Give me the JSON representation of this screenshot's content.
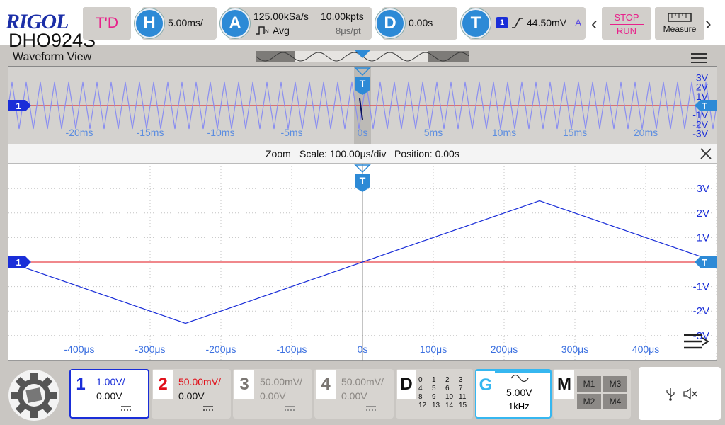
{
  "header": {
    "logo": "RIGOL",
    "model": "DHO924S",
    "td_button": "T'D",
    "horizontal": {
      "icon": "H",
      "scale": "5.00ms/"
    },
    "acquire": {
      "icon": "A",
      "sample_rate": "125.00kSa/s",
      "points": "10.00kpts",
      "mode": "Avg",
      "time_per_point": "8μs/pt"
    },
    "delay": {
      "icon": "D",
      "value": "0.00s"
    },
    "trigger": {
      "icon": "T",
      "source": "1",
      "level": "44.50mV",
      "mode": "A"
    },
    "stop_label": "STOP",
    "run_label": "RUN",
    "measure_label": "Measure"
  },
  "view": {
    "title": "Waveform View"
  },
  "overview": {
    "time_labels": [
      "-20ms",
      "-15ms",
      "-10ms",
      "-5ms",
      "0s",
      "5ms",
      "10ms",
      "15ms",
      "20ms"
    ],
    "volt_labels": [
      "3V",
      "2V",
      "1V",
      "-1V",
      "-2V",
      "-3V"
    ],
    "trigger_marker": "T",
    "channel_marker": "1"
  },
  "zoom": {
    "title": "Zoom",
    "scale": "Scale: 100.00μs/div",
    "position": "Position: 0.00s",
    "time_labels": [
      "-400μs",
      "-300μs",
      "-200μs",
      "-100μs",
      "0s",
      "100μs",
      "200μs",
      "300μs",
      "400μs"
    ],
    "volt_labels": [
      "3V",
      "2V",
      "1V",
      "-1V",
      "-2V",
      "-3V"
    ],
    "trigger_marker": "T",
    "channel_marker": "1"
  },
  "channels": [
    {
      "num": "1",
      "scale": "1.00V/",
      "offset": "0.00V",
      "color": "#1a2ed8",
      "active": true
    },
    {
      "num": "2",
      "scale": "50.00mV/",
      "offset": "0.00V",
      "color": "#e0101a",
      "active": false
    },
    {
      "num": "3",
      "scale": "50.00mV/",
      "offset": "0.00V",
      "color": "#7a7672",
      "active": false
    },
    {
      "num": "4",
      "scale": "50.00mV/",
      "offset": "0.00V",
      "color": "#7a7672",
      "active": false
    }
  ],
  "digital": {
    "label": "D",
    "bits": [
      "0",
      "1",
      "2",
      "3",
      "4",
      "5",
      "6",
      "7",
      "8",
      "9",
      "10",
      "11",
      "12",
      "13",
      "14",
      "15"
    ]
  },
  "generator": {
    "label": "G",
    "amplitude": "5.00V",
    "frequency": "1kHz"
  },
  "math": {
    "label": "M",
    "slots": [
      "M1",
      "M3",
      "M2",
      "M4"
    ]
  },
  "colors": {
    "ch1": "#1a2ed8",
    "ch2": "#e0101a",
    "ch1_overview": "#8a8ef0",
    "accent": "#2d8ad6",
    "trigger_pink": "#e8208a"
  }
}
